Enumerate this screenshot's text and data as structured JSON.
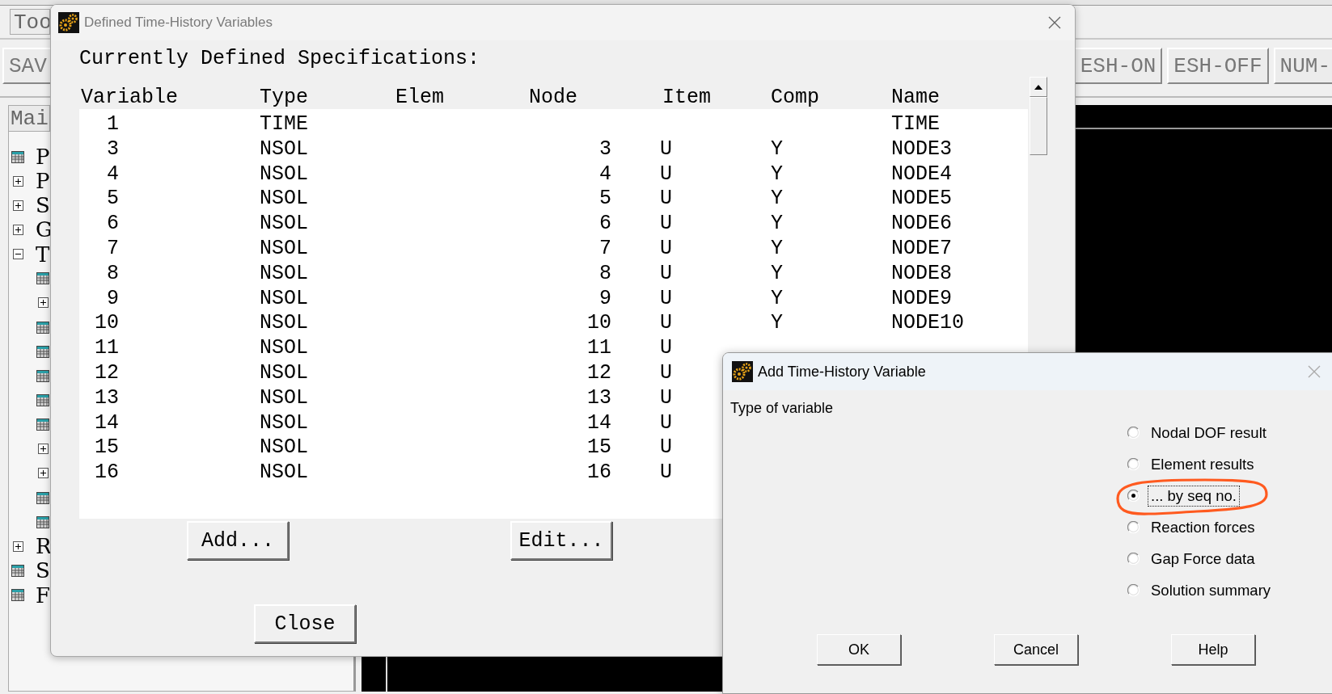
{
  "background_window": {
    "menu_label": "Too",
    "left_toolbar_buttons": [
      "SAV"
    ],
    "right_toolbar_buttons": [
      "ESH-ON",
      "ESH-OFF",
      "NUM-"
    ],
    "tree_tab": "Mai",
    "tree": [
      {
        "label": "P",
        "kind": "leaf"
      },
      {
        "label": "P",
        "kind": "folder",
        "expanded": false
      },
      {
        "label": "S",
        "kind": "folder",
        "expanded": false
      },
      {
        "label": "G",
        "kind": "folder",
        "expanded": false
      },
      {
        "label": "T",
        "kind": "folder",
        "expanded": true,
        "children": [
          {
            "kind": "leaf"
          },
          {
            "kind": "folder",
            "expanded": false
          },
          {
            "kind": "leaf"
          },
          {
            "kind": "leaf"
          },
          {
            "kind": "leaf"
          },
          {
            "kind": "leaf"
          },
          {
            "kind": "leaf"
          },
          {
            "kind": "folder",
            "expanded": false
          },
          {
            "kind": "folder",
            "expanded": false
          },
          {
            "kind": "leaf"
          },
          {
            "kind": "leaf"
          }
        ]
      },
      {
        "label": "R",
        "kind": "folder",
        "expanded": false
      },
      {
        "label": "S",
        "kind": "leaf"
      },
      {
        "label": "F",
        "kind": "leaf"
      }
    ]
  },
  "defined_dialog": {
    "title": "Defined Time-History Variables",
    "heading": "Currently Defined Specifications:",
    "columns": [
      "Variable",
      "Type",
      "Elem",
      "Node",
      "Item",
      "Comp",
      "Name"
    ],
    "rows": [
      {
        "variable": "1",
        "type": "TIME",
        "name": "TIME"
      },
      {
        "variable": "3",
        "type": "NSOL",
        "node": "3",
        "item": "U",
        "comp": "Y",
        "name": "NODE3"
      },
      {
        "variable": "4",
        "type": "NSOL",
        "node": "4",
        "item": "U",
        "comp": "Y",
        "name": "NODE4"
      },
      {
        "variable": "5",
        "type": "NSOL",
        "node": "5",
        "item": "U",
        "comp": "Y",
        "name": "NODE5"
      },
      {
        "variable": "6",
        "type": "NSOL",
        "node": "6",
        "item": "U",
        "comp": "Y",
        "name": "NODE6"
      },
      {
        "variable": "7",
        "type": "NSOL",
        "node": "7",
        "item": "U",
        "comp": "Y",
        "name": "NODE7"
      },
      {
        "variable": "8",
        "type": "NSOL",
        "node": "8",
        "item": "U",
        "comp": "Y",
        "name": "NODE8"
      },
      {
        "variable": "9",
        "type": "NSOL",
        "node": "9",
        "item": "U",
        "comp": "Y",
        "name": "NODE9"
      },
      {
        "variable": "10",
        "type": "NSOL",
        "node": "10",
        "item": "U",
        "comp": "Y",
        "name": "NODE10"
      },
      {
        "variable": "11",
        "type": "NSOL",
        "node": "11",
        "item": "U"
      },
      {
        "variable": "12",
        "type": "NSOL",
        "node": "12",
        "item": "U"
      },
      {
        "variable": "13",
        "type": "NSOL",
        "node": "13",
        "item": "U"
      },
      {
        "variable": "14",
        "type": "NSOL",
        "node": "14",
        "item": "U"
      },
      {
        "variable": "15",
        "type": "NSOL",
        "node": "15",
        "item": "U"
      },
      {
        "variable": "16",
        "type": "NSOL",
        "node": "16",
        "item": "U"
      }
    ],
    "buttons": [
      "Add...",
      "Edit...",
      "Close"
    ]
  },
  "add_dialog": {
    "title": "Add Time-History Variable",
    "label": "Type of variable",
    "options": [
      {
        "label": "Nodal DOF result",
        "selected": false
      },
      {
        "label": "Element results",
        "selected": false
      },
      {
        "label": "... by seq no.",
        "selected": true
      },
      {
        "label": "Reaction forces",
        "selected": false
      },
      {
        "label": "Gap Force data",
        "selected": false
      },
      {
        "label": "Solution summary",
        "selected": false
      }
    ],
    "buttons": [
      "OK",
      "Cancel",
      "Help"
    ]
  }
}
